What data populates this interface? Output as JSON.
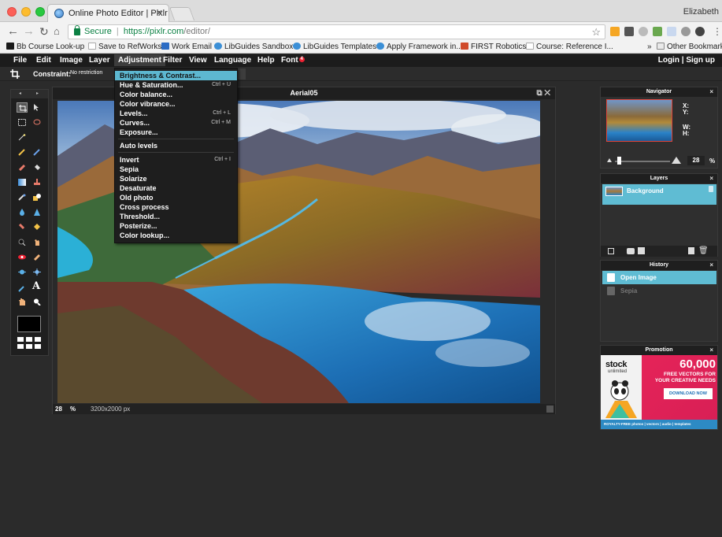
{
  "browser": {
    "tab_title": "Online Photo Editor | Pixlr Editor",
    "profile_name": "Elizabeth",
    "secure_label": "Secure",
    "url_host": "https://pixlr.com",
    "url_path": "/editor/"
  },
  "bookmarks": [
    {
      "label": "Bb Course Look-up",
      "color": "#1a1a1a"
    },
    {
      "label": "Save to RefWorks",
      "color": "#bbbbbb"
    },
    {
      "label": "Work Email",
      "color": "#2b6cc4"
    },
    {
      "label": "LibGuides Sandbox",
      "color": "#3b8fd6"
    },
    {
      "label": "LibGuides Templates",
      "color": "#3b8fd6"
    },
    {
      "label": "Apply Framework in...",
      "color": "#3b8fd6"
    },
    {
      "label": "FIRST Robotics",
      "color": "#d04a2a"
    },
    {
      "label": "Course: Reference I...",
      "color": "#bbbbbb"
    }
  ],
  "bookmarks_more": "»",
  "other_bookmarks": "Other Bookmarks",
  "menu": {
    "file": "File",
    "edit": "Edit",
    "image": "Image",
    "layer": "Layer",
    "adjustment": "Adjustment",
    "filter": "Filter",
    "view": "View",
    "language": "Language",
    "help": "Help",
    "font": "Font",
    "font_badge": "4",
    "login": "Login",
    "auth_sep": "|",
    "signup": "Sign up"
  },
  "options": {
    "constraint_label": "Constraint:",
    "constraint_value": "No restriction"
  },
  "adjustment_menu": [
    {
      "label": "Brightness & Contrast...",
      "shortcut": ""
    },
    {
      "label": "Hue & Saturation...",
      "shortcut": "Ctrl + U"
    },
    {
      "label": "Color balance...",
      "shortcut": ""
    },
    {
      "label": "Color vibrance...",
      "shortcut": ""
    },
    {
      "label": "Levels...",
      "shortcut": "Ctrl + L"
    },
    {
      "label": "Curves...",
      "shortcut": "Ctrl + M"
    },
    {
      "label": "Exposure...",
      "shortcut": ""
    },
    {
      "label": "Auto levels",
      "shortcut": ""
    },
    {
      "label": "Invert",
      "shortcut": "Ctrl + I"
    },
    {
      "label": "Sepia",
      "shortcut": ""
    },
    {
      "label": "Solarize",
      "shortcut": ""
    },
    {
      "label": "Desaturate",
      "shortcut": ""
    },
    {
      "label": "Old photo",
      "shortcut": ""
    },
    {
      "label": "Cross process",
      "shortcut": ""
    },
    {
      "label": "Threshold...",
      "shortcut": ""
    },
    {
      "label": "Posterize...",
      "shortcut": ""
    },
    {
      "label": "Color lookup...",
      "shortcut": ""
    }
  ],
  "image_window": {
    "title": "Aerial05",
    "zoom": "28",
    "zoom_unit": "%",
    "dimensions": "3200x2000 px"
  },
  "navigator": {
    "title": "Navigator",
    "x_label": "X:",
    "y_label": "Y:",
    "w_label": "W:",
    "h_label": "H:",
    "zoom_value": "28",
    "zoom_unit": "%"
  },
  "layers": {
    "title": "Layers",
    "items": [
      "Background"
    ]
  },
  "history": {
    "title": "History",
    "items": [
      "Open Image",
      "Sepia"
    ]
  },
  "promotion": {
    "title": "Promotion",
    "brand_top": "stock",
    "brand_bottom": "unlimited",
    "count": "60,000",
    "line1": "FREE VECTORS FOR",
    "line2": "YOUR CREATIVE NEEDS",
    "cta": "DOWNLOAD NOW",
    "footer": "ROYALTY-FREE  photos | vectors | audio | templates"
  },
  "colors": {
    "accent": "#5fbcd3",
    "menu_highlight": "#5db7d0",
    "badge": "#e22233"
  }
}
